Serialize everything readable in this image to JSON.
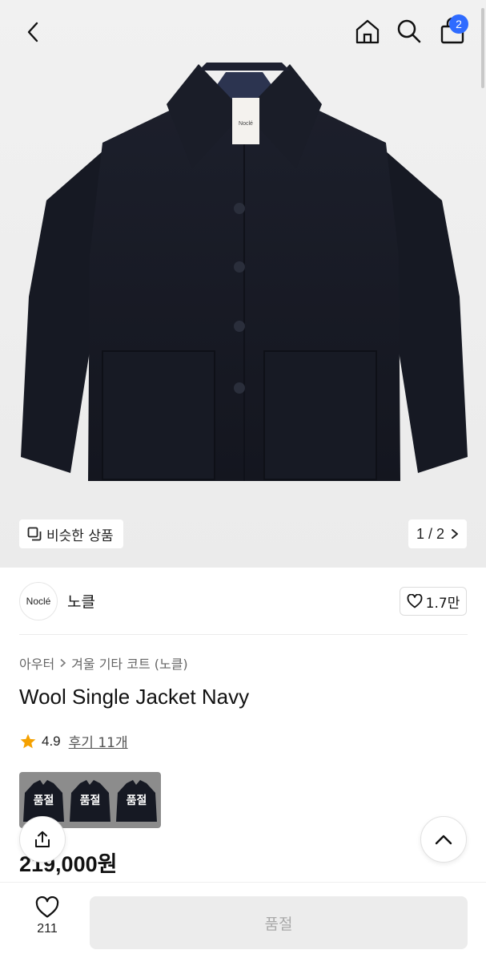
{
  "header": {
    "back_icon": "chevron-left-icon",
    "home_icon": "home-icon",
    "search_icon": "search-icon",
    "cart_icon": "shopping-bag-icon",
    "cart_badge": "2",
    "badge_color": "#2f6bff"
  },
  "gallery": {
    "similar_label": "비슷한 상품",
    "pager": "1 / 2"
  },
  "brand": {
    "logo_text": "Noclé",
    "name": "노클",
    "like_count": "1.7만"
  },
  "product": {
    "breadcrumb": [
      "아우터",
      "겨울 기타 코트 (노클)"
    ],
    "title": "Wool Single Jacket Navy",
    "rating": "4.9",
    "reviews": "후기 11개",
    "options": [
      "품절",
      "품절",
      "품절"
    ],
    "price": "219,000원"
  },
  "bottom": {
    "wish_count": "211",
    "buy_label": "품절"
  }
}
